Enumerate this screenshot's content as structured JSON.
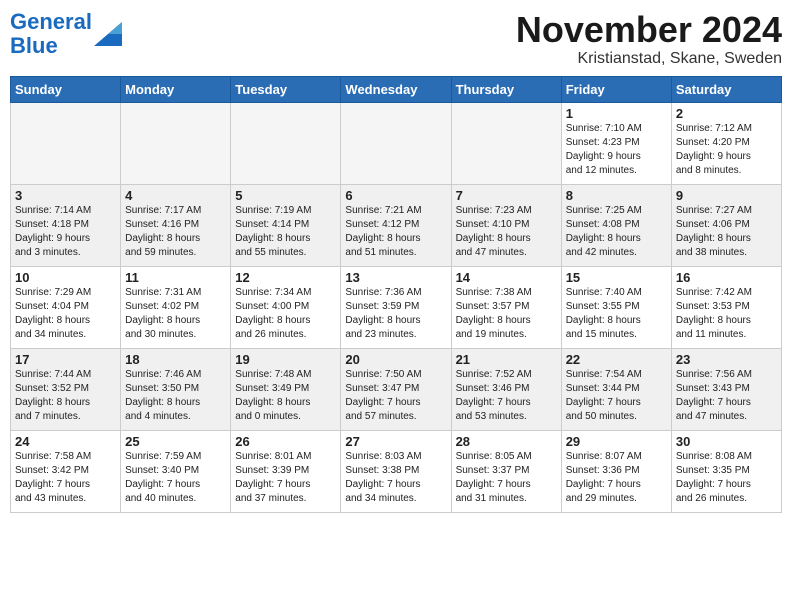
{
  "header": {
    "logo_line1": "General",
    "logo_line2": "Blue",
    "month": "November 2024",
    "location": "Kristianstad, Skane, Sweden"
  },
  "days_of_week": [
    "Sunday",
    "Monday",
    "Tuesday",
    "Wednesday",
    "Thursday",
    "Friday",
    "Saturday"
  ],
  "weeks": [
    [
      {
        "day": "",
        "info": ""
      },
      {
        "day": "",
        "info": ""
      },
      {
        "day": "",
        "info": ""
      },
      {
        "day": "",
        "info": ""
      },
      {
        "day": "",
        "info": ""
      },
      {
        "day": "1",
        "info": "Sunrise: 7:10 AM\nSunset: 4:23 PM\nDaylight: 9 hours\nand 12 minutes."
      },
      {
        "day": "2",
        "info": "Sunrise: 7:12 AM\nSunset: 4:20 PM\nDaylight: 9 hours\nand 8 minutes."
      }
    ],
    [
      {
        "day": "3",
        "info": "Sunrise: 7:14 AM\nSunset: 4:18 PM\nDaylight: 9 hours\nand 3 minutes."
      },
      {
        "day": "4",
        "info": "Sunrise: 7:17 AM\nSunset: 4:16 PM\nDaylight: 8 hours\nand 59 minutes."
      },
      {
        "day": "5",
        "info": "Sunrise: 7:19 AM\nSunset: 4:14 PM\nDaylight: 8 hours\nand 55 minutes."
      },
      {
        "day": "6",
        "info": "Sunrise: 7:21 AM\nSunset: 4:12 PM\nDaylight: 8 hours\nand 51 minutes."
      },
      {
        "day": "7",
        "info": "Sunrise: 7:23 AM\nSunset: 4:10 PM\nDaylight: 8 hours\nand 47 minutes."
      },
      {
        "day": "8",
        "info": "Sunrise: 7:25 AM\nSunset: 4:08 PM\nDaylight: 8 hours\nand 42 minutes."
      },
      {
        "day": "9",
        "info": "Sunrise: 7:27 AM\nSunset: 4:06 PM\nDaylight: 8 hours\nand 38 minutes."
      }
    ],
    [
      {
        "day": "10",
        "info": "Sunrise: 7:29 AM\nSunset: 4:04 PM\nDaylight: 8 hours\nand 34 minutes."
      },
      {
        "day": "11",
        "info": "Sunrise: 7:31 AM\nSunset: 4:02 PM\nDaylight: 8 hours\nand 30 minutes."
      },
      {
        "day": "12",
        "info": "Sunrise: 7:34 AM\nSunset: 4:00 PM\nDaylight: 8 hours\nand 26 minutes."
      },
      {
        "day": "13",
        "info": "Sunrise: 7:36 AM\nSunset: 3:59 PM\nDaylight: 8 hours\nand 23 minutes."
      },
      {
        "day": "14",
        "info": "Sunrise: 7:38 AM\nSunset: 3:57 PM\nDaylight: 8 hours\nand 19 minutes."
      },
      {
        "day": "15",
        "info": "Sunrise: 7:40 AM\nSunset: 3:55 PM\nDaylight: 8 hours\nand 15 minutes."
      },
      {
        "day": "16",
        "info": "Sunrise: 7:42 AM\nSunset: 3:53 PM\nDaylight: 8 hours\nand 11 minutes."
      }
    ],
    [
      {
        "day": "17",
        "info": "Sunrise: 7:44 AM\nSunset: 3:52 PM\nDaylight: 8 hours\nand 7 minutes."
      },
      {
        "day": "18",
        "info": "Sunrise: 7:46 AM\nSunset: 3:50 PM\nDaylight: 8 hours\nand 4 minutes."
      },
      {
        "day": "19",
        "info": "Sunrise: 7:48 AM\nSunset: 3:49 PM\nDaylight: 8 hours\nand 0 minutes."
      },
      {
        "day": "20",
        "info": "Sunrise: 7:50 AM\nSunset: 3:47 PM\nDaylight: 7 hours\nand 57 minutes."
      },
      {
        "day": "21",
        "info": "Sunrise: 7:52 AM\nSunset: 3:46 PM\nDaylight: 7 hours\nand 53 minutes."
      },
      {
        "day": "22",
        "info": "Sunrise: 7:54 AM\nSunset: 3:44 PM\nDaylight: 7 hours\nand 50 minutes."
      },
      {
        "day": "23",
        "info": "Sunrise: 7:56 AM\nSunset: 3:43 PM\nDaylight: 7 hours\nand 47 minutes."
      }
    ],
    [
      {
        "day": "24",
        "info": "Sunrise: 7:58 AM\nSunset: 3:42 PM\nDaylight: 7 hours\nand 43 minutes."
      },
      {
        "day": "25",
        "info": "Sunrise: 7:59 AM\nSunset: 3:40 PM\nDaylight: 7 hours\nand 40 minutes."
      },
      {
        "day": "26",
        "info": "Sunrise: 8:01 AM\nSunset: 3:39 PM\nDaylight: 7 hours\nand 37 minutes."
      },
      {
        "day": "27",
        "info": "Sunrise: 8:03 AM\nSunset: 3:38 PM\nDaylight: 7 hours\nand 34 minutes."
      },
      {
        "day": "28",
        "info": "Sunrise: 8:05 AM\nSunset: 3:37 PM\nDaylight: 7 hours\nand 31 minutes."
      },
      {
        "day": "29",
        "info": "Sunrise: 8:07 AM\nSunset: 3:36 PM\nDaylight: 7 hours\nand 29 minutes."
      },
      {
        "day": "30",
        "info": "Sunrise: 8:08 AM\nSunset: 3:35 PM\nDaylight: 7 hours\nand 26 minutes."
      }
    ]
  ]
}
